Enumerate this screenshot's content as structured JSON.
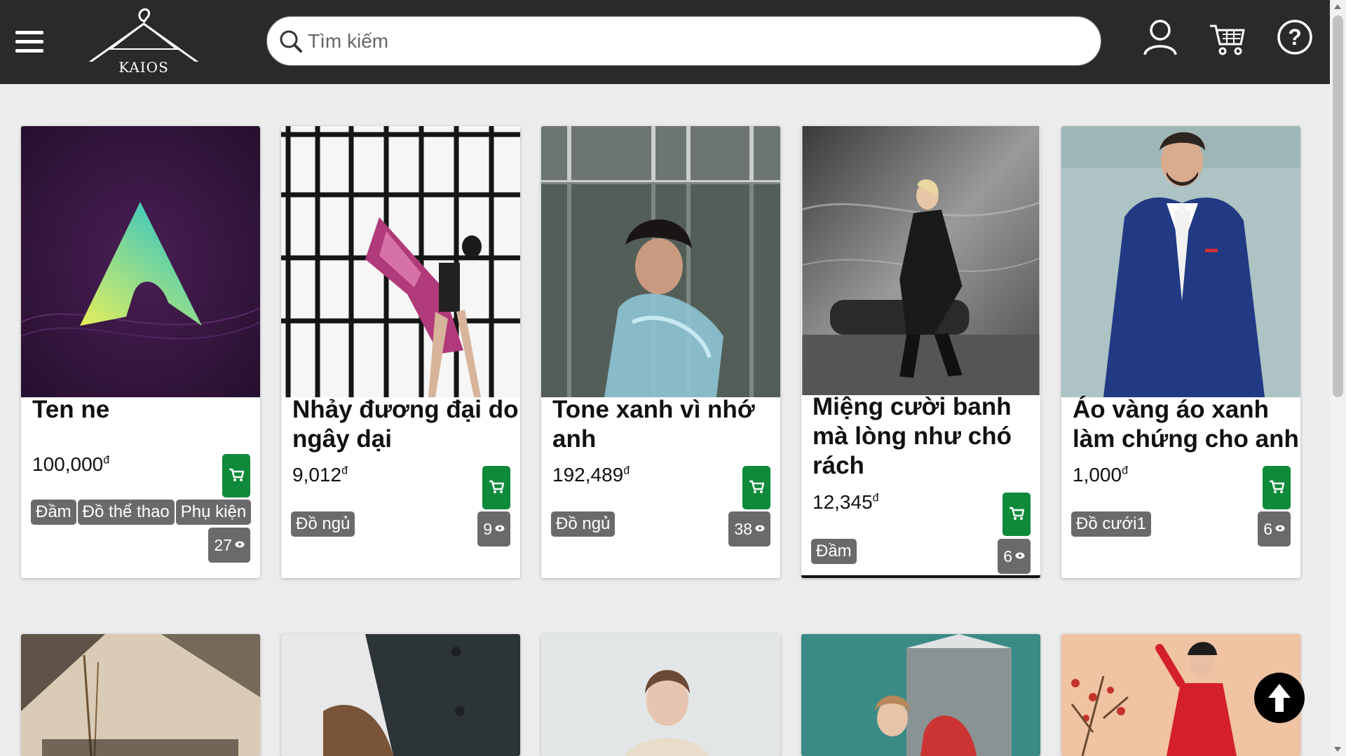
{
  "header": {
    "logo_text": "KAIOS",
    "search_placeholder": "Tìm kiếm"
  },
  "products": [
    {
      "title": "Ten ne",
      "price": "100,000",
      "currency": "đ",
      "tags": [
        "Đầm",
        "Đồ thể thao",
        "Phụ kiện"
      ],
      "views": "27"
    },
    {
      "title": "Nhảy đương đại do ngây dại",
      "price": "9,012",
      "currency": "đ",
      "tags": [
        "Đồ ngủ"
      ],
      "views": "9"
    },
    {
      "title": "Tone xanh vì nhớ anh",
      "price": "192,489",
      "currency": "đ",
      "tags": [
        "Đồ ngủ"
      ],
      "views": "38"
    },
    {
      "title": "Miệng cười banh mà lòng như chó rách",
      "price": "12,345",
      "currency": "đ",
      "tags": [
        "Đầm"
      ],
      "views": "6"
    },
    {
      "title": "Áo vàng áo xanh làm chứng cho anh",
      "price": "1,000",
      "currency": "đ",
      "tags": [
        "Đồ cưới1"
      ],
      "views": "6"
    }
  ],
  "colors": {
    "header_bg": "#2a2a2a",
    "page_bg": "#ececec",
    "cart_button": "#0f8a3a",
    "tag_bg": "#6a6a6a"
  }
}
